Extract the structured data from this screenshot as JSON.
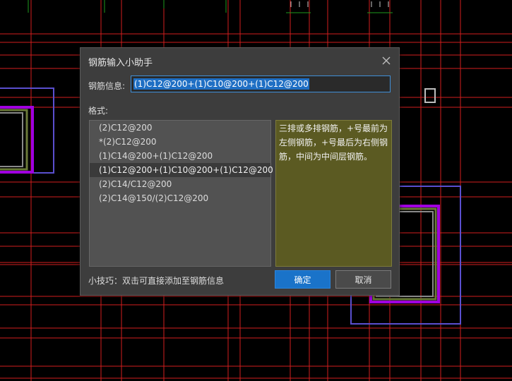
{
  "dialog": {
    "title": "钢筋输入小助手",
    "info_label": "钢筋信息:",
    "info_value": "(1)C12@200+(1)C10@200+(1)C12@200",
    "format_label": "格式:",
    "formats": [
      {
        "label": "(2)C12@200",
        "selected": false
      },
      {
        "label": "*(2)C12@200",
        "selected": false
      },
      {
        "label": "(1)C14@200+(1)C12@200",
        "selected": false
      },
      {
        "label": "(1)C12@200+(1)C10@200+(1)C12@200",
        "selected": true
      },
      {
        "label": "(2)C14/C12@200",
        "selected": false
      },
      {
        "label": "(2)C14@150/(2)C12@200",
        "selected": false
      }
    ],
    "description": "三排或多排钢筋，+号最前为左侧钢筋，+号最后为右侧钢筋，中间为中间层钢筋。",
    "tip": "小技巧：双击可直接添加至钢筋信息",
    "ok_label": "确定",
    "cancel_label": "取消"
  },
  "colors": {
    "accent": "#1a73c9",
    "description_bg": "#5b5a22",
    "cad_grid_red": "#d21e1e",
    "cad_outline_blue": "#5a4fcf",
    "cad_column_magenta": "#a000e0"
  },
  "icons": {
    "close": "close-icon"
  }
}
